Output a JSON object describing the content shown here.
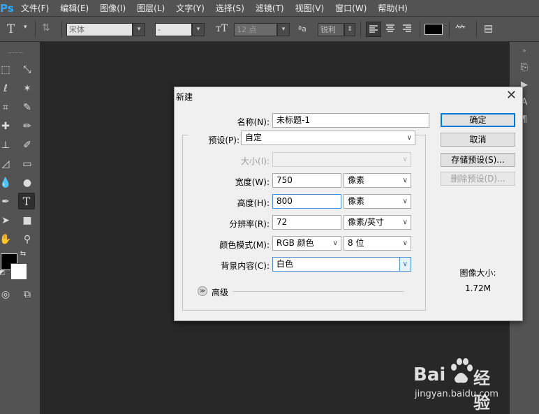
{
  "app": {
    "logo_text": "Ps"
  },
  "menu": [
    "文件(F)",
    "编辑(E)",
    "图像(I)",
    "图层(L)",
    "文字(Y)",
    "选择(S)",
    "滤镜(T)",
    "视图(V)",
    "窗口(W)",
    "帮助(H)"
  ],
  "options_bar": {
    "font_family": "宋体",
    "font_style": "-",
    "font_size": "12 点",
    "aa_label": "ªa",
    "antialias": "锐利",
    "text_color": "#000000"
  },
  "dialog": {
    "title": "新建",
    "name_label": "名称(N):",
    "name_value": "未标题-1",
    "preset_label": "预设(P):",
    "preset_value": "自定",
    "size_label": "大小(I):",
    "width_label": "宽度(W):",
    "width_value": "750",
    "width_unit": "像素",
    "height_label": "高度(H):",
    "height_value": "800",
    "height_unit": "像素",
    "resolution_label": "分辨率(R):",
    "resolution_value": "72",
    "resolution_unit": "像素/英寸",
    "colormode_label": "颜色模式(M):",
    "colormode_value": "RGB 颜色",
    "bitdepth_value": "8 位",
    "background_label": "背景内容(C):",
    "background_value": "白色",
    "advanced_label": "高级",
    "buttons": {
      "ok": "确定",
      "cancel": "取消",
      "save_preset": "存储预设(S)...",
      "delete_preset": "删除预设(D)..."
    },
    "image_size_label": "图像大小:",
    "image_size_value": "1.72M"
  },
  "watermark": {
    "brand_left": "Bai",
    "brand_right": "经验",
    "url": "jingyan.baidu.com"
  },
  "colors": {
    "foreground": "#000000",
    "background": "#ffffff",
    "accent": "#0078d7"
  }
}
